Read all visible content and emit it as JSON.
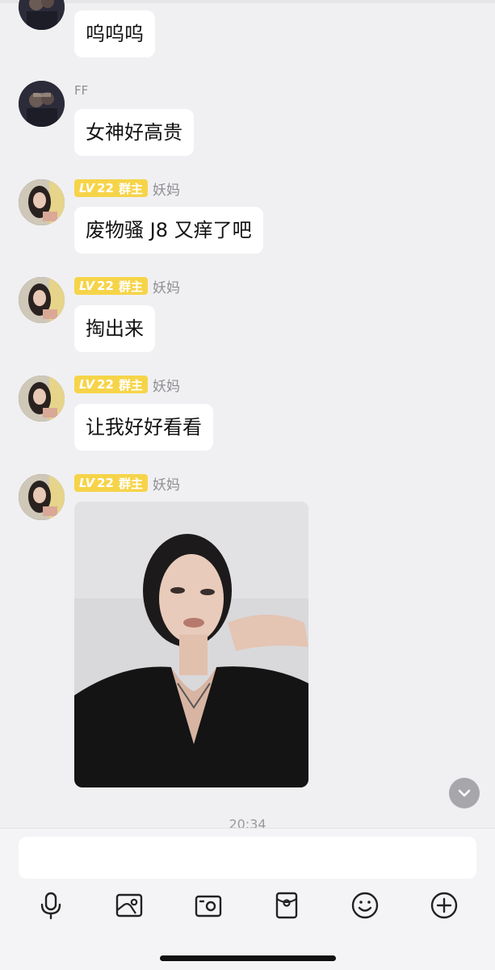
{
  "messages": [
    {
      "sender_label": "",
      "text": "呜呜呜"
    },
    {
      "sender_label": "FF",
      "text": "女神好高贵"
    },
    {
      "badge_lv": "LV",
      "badge_level": "22",
      "badge_role": "群主",
      "nickname": "妖妈",
      "text": "废物骚 J8 又痒了吧"
    },
    {
      "badge_lv": "LV",
      "badge_level": "22",
      "badge_role": "群主",
      "nickname": "妖妈",
      "text": "掏出来"
    },
    {
      "badge_lv": "LV",
      "badge_level": "22",
      "badge_role": "群主",
      "nickname": "妖妈",
      "text": "让我好好看看"
    },
    {
      "badge_lv": "LV",
      "badge_level": "22",
      "badge_role": "群主",
      "nickname": "妖妈",
      "type": "image"
    }
  ],
  "timestamp": "20:34",
  "composer": {
    "input_value": "",
    "tools": [
      "microphone-icon",
      "image-gallery-icon",
      "camera-icon",
      "red-packet-icon",
      "emoji-icon",
      "plus-icon"
    ]
  },
  "colors": {
    "background": "#f0f0f2",
    "bubble": "#ffffff",
    "badge": "#f6d449",
    "secondary_text": "#8e8e93"
  }
}
